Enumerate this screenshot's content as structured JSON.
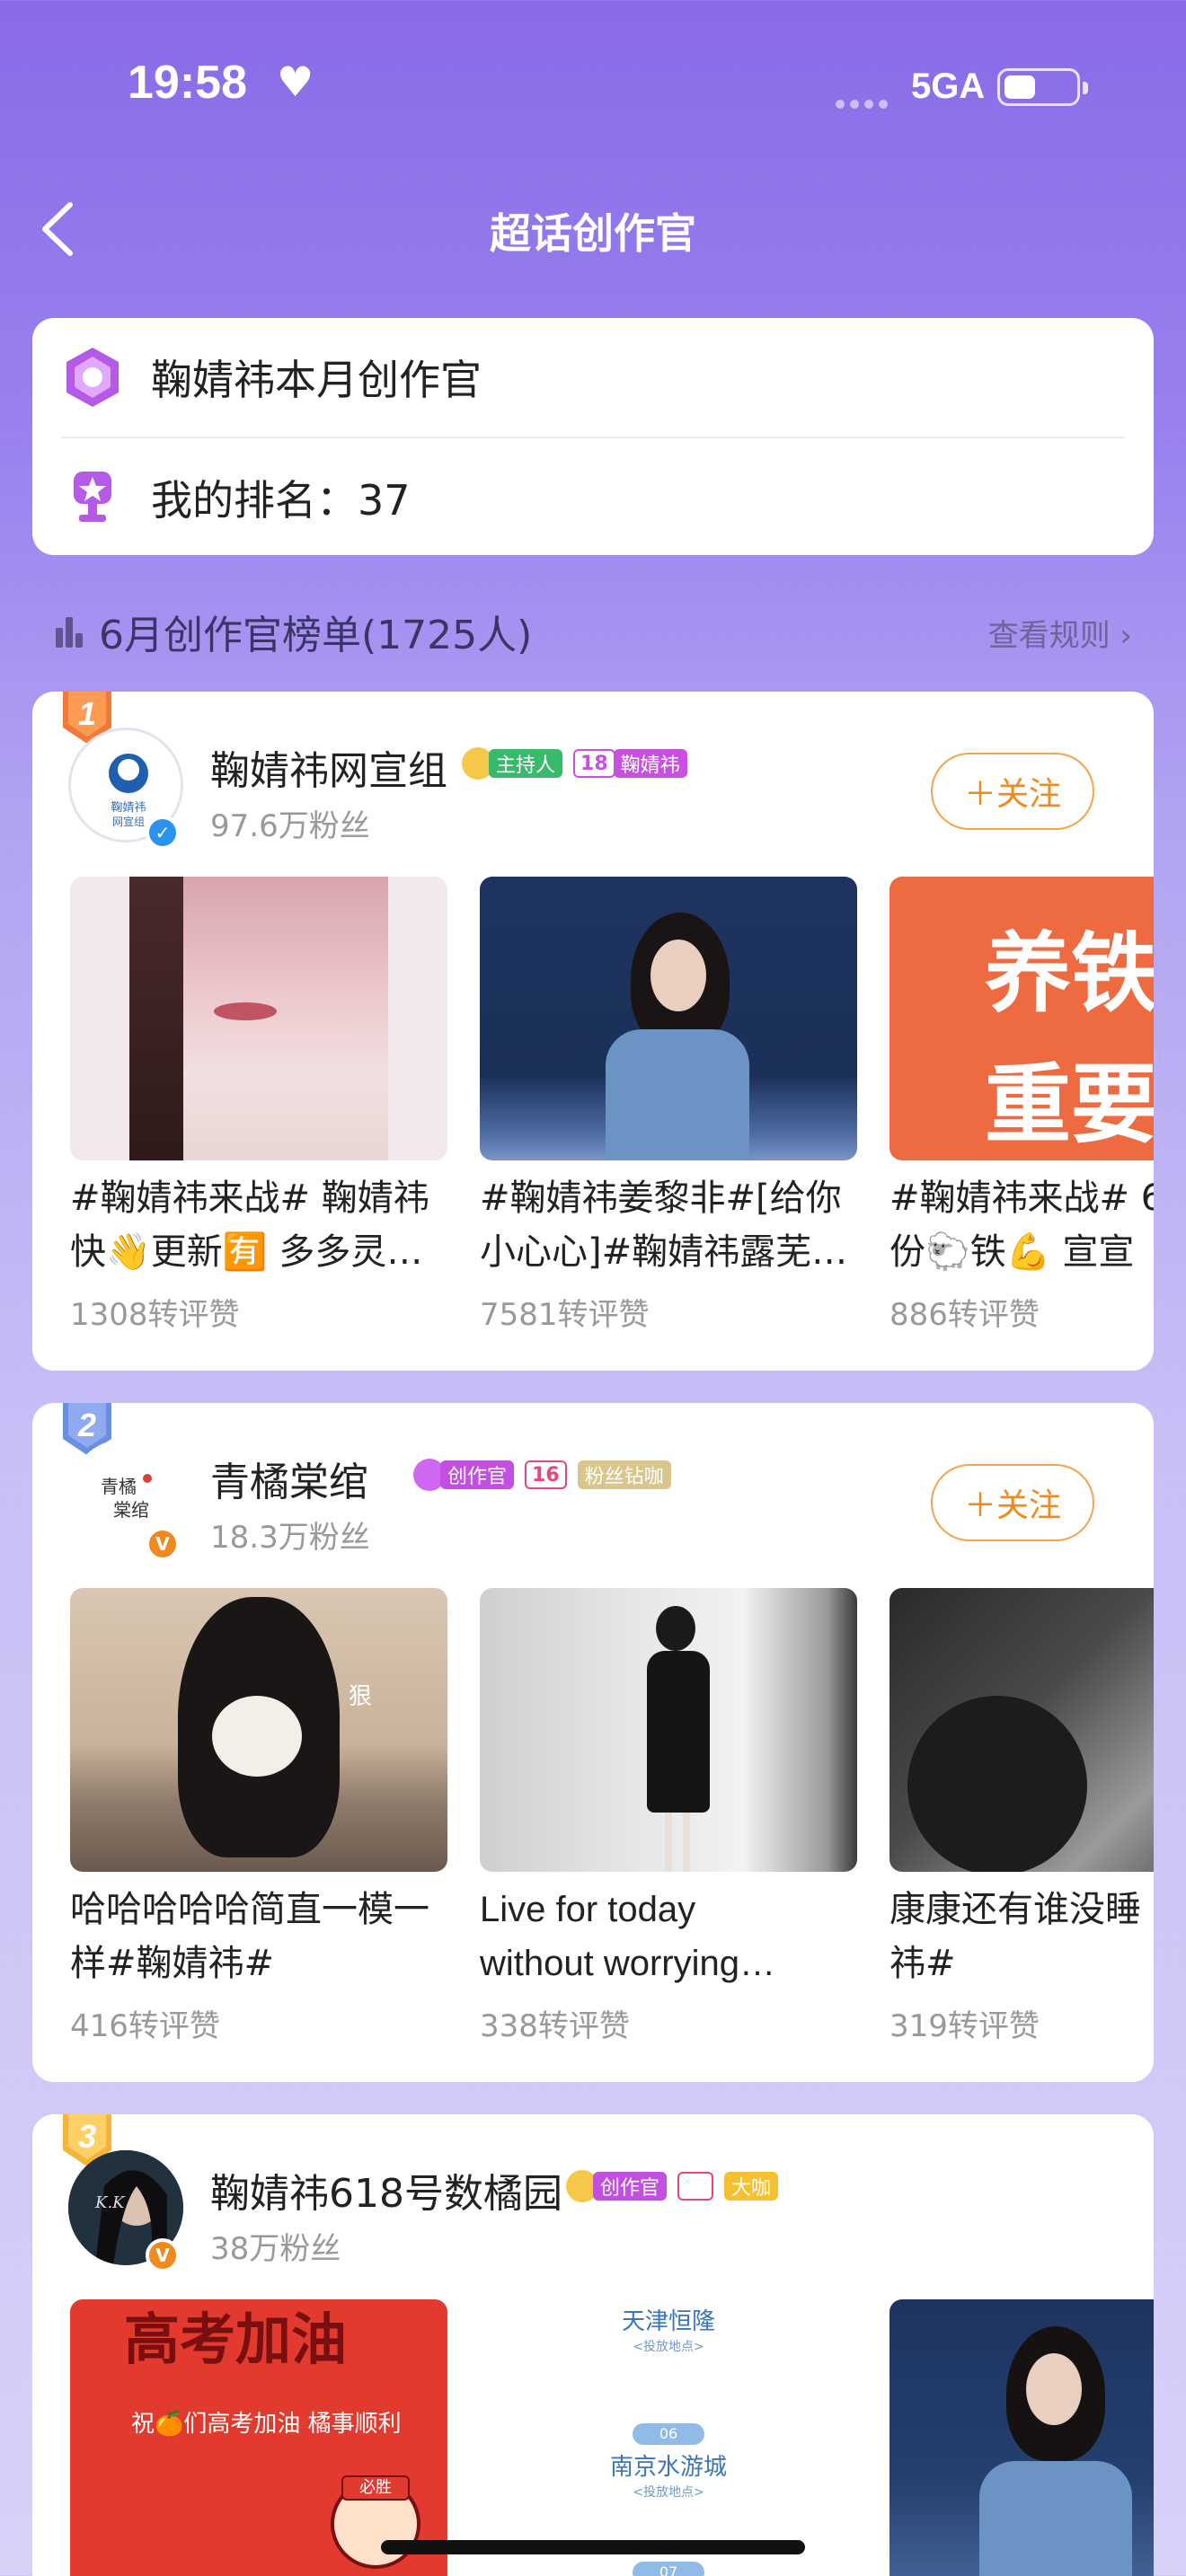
{
  "status": {
    "time": "19:58",
    "network": "5GA"
  },
  "nav": {
    "title": "超话创作官"
  },
  "info": {
    "creator_label": "鞠婧祎本月创作官",
    "my_rank_label": "我的排名：37"
  },
  "list": {
    "title": "6月创作官榜单(1725人)",
    "rules_link": "查看规则"
  },
  "cards": [
    {
      "rank": "1",
      "name": "鞠婧祎网宣组",
      "badges": [
        "主持人",
        "18",
        "鞠婧祎"
      ],
      "fans": "97.6万粉丝",
      "follow": "＋关注",
      "avatar_text": "鞠婧祎\n网宣组",
      "posts": [
        {
          "lines": [
            "#鞠婧祎来战# 鞠婧祎",
            "快👋更新🈶 多多灵…"
          ],
          "stat": "1308转评赞"
        },
        {
          "lines": [
            "#鞠婧祎姜黎非#[给你",
            "小心心]#鞠婧祎露芜…"
          ],
          "stat": "7581转评赞"
        },
        {
          "lines": [
            "#鞠婧祎来战# 6",
            "份🐑铁💪 宣宣"
          ],
          "stat": "886转评赞",
          "thumb_text": [
            "养铁",
            "重要"
          ]
        }
      ]
    },
    {
      "rank": "2",
      "name": "青橘棠绾",
      "badges": [
        "创作官",
        "16",
        "粉丝钻咖"
      ],
      "fans": "18.3万粉丝",
      "follow": "＋关注",
      "avatar_text": "青橘\n棠绾",
      "posts": [
        {
          "lines": [
            "哈哈哈哈哈简直一模一",
            "样#鞠婧祎#"
          ],
          "stat": "416转评赞",
          "thumb_text": [
            "狠"
          ]
        },
        {
          "lines": [
            "Live for today",
            "without worrying…"
          ],
          "stat": "338转评赞"
        },
        {
          "lines": [
            "康康还有谁没睡",
            "祎#"
          ],
          "stat": "319转评赞"
        }
      ]
    },
    {
      "rank": "3",
      "name": "鞠婧祎618号数橘园",
      "badges": [
        "创作官",
        "",
        "大咖"
      ],
      "fans": "38万粉丝",
      "avatar_text": "K.K",
      "posts": [
        {
          "thumb_text": [
            "高考加油",
            "祝🍊们高考加油 橘事顺利",
            "必胜"
          ]
        },
        {
          "thumb_text": [
            "天津恒隆",
            "<投放地点>",
            "06",
            "南京水游城",
            "<投放地点>",
            "07"
          ]
        },
        {}
      ]
    }
  ]
}
